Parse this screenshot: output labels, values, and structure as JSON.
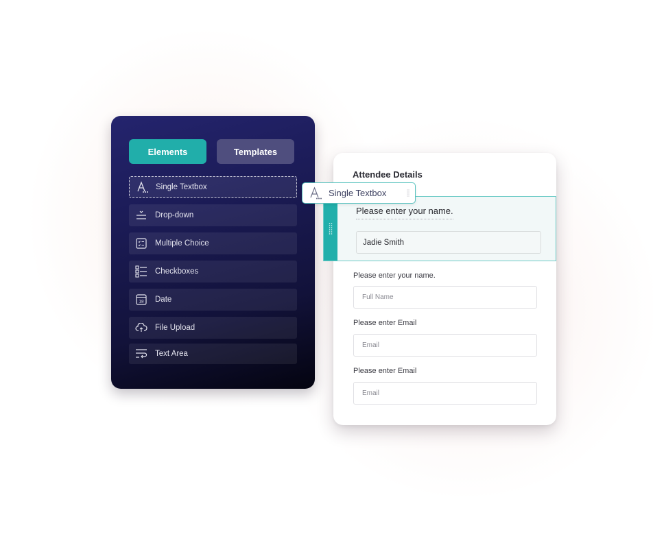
{
  "panel": {
    "tabs": [
      {
        "label": "Elements",
        "active": true
      },
      {
        "label": "Templates",
        "active": false
      }
    ],
    "items": [
      {
        "label": "Single Textbox",
        "icon": "text-icon",
        "state": "dragging-source"
      },
      {
        "label": "Drop-down",
        "icon": "dropdown-icon"
      },
      {
        "label": "Multiple Choice",
        "icon": "multiple-choice-icon"
      },
      {
        "label": "Checkboxes",
        "icon": "checkbox-list-icon"
      },
      {
        "label": "Date",
        "icon": "calendar-icon",
        "icon_text": "18"
      },
      {
        "label": "File Upload",
        "icon": "cloud-upload-icon"
      },
      {
        "label": "Text Area",
        "icon": "text-wrap-icon"
      }
    ]
  },
  "drag_chip": {
    "label": "Single Textbox",
    "icon": "text-icon"
  },
  "form": {
    "title": "Attendee Details",
    "selected_field": {
      "label": "Please enter your name.",
      "value": "Jadie Smith"
    },
    "fields": [
      {
        "label": "Please enter your name.",
        "placeholder": "Full Name"
      },
      {
        "label": "Please enter Email",
        "placeholder": "Email"
      },
      {
        "label": "Please enter Email",
        "placeholder": "Email"
      }
    ]
  },
  "colors": {
    "accent_teal": "#21aeaa",
    "panel_dark": "#1b1b55",
    "tab_inactive": "#4f4e7e"
  }
}
